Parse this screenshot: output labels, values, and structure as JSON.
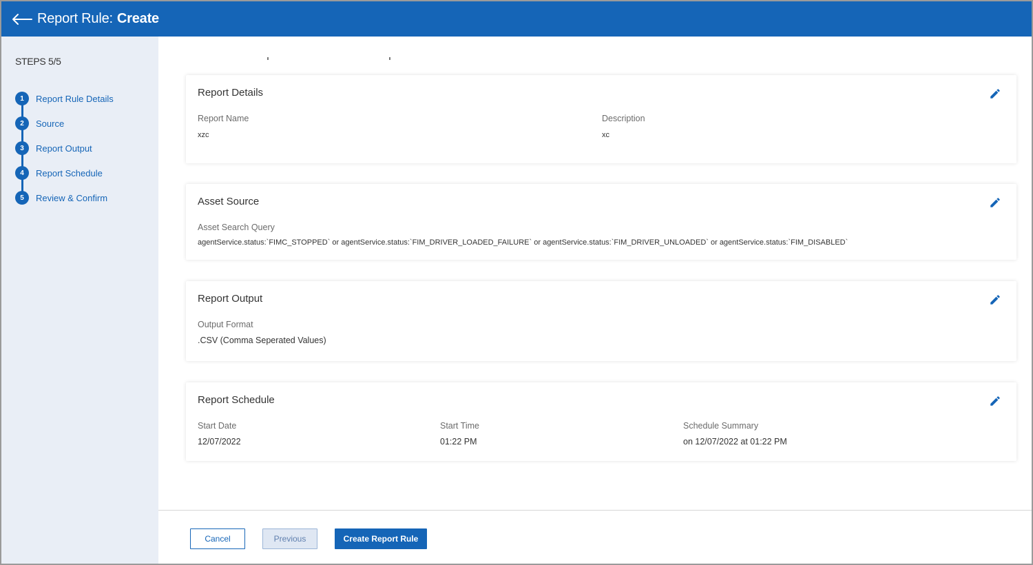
{
  "header": {
    "title_label": "Report Rule:",
    "title_action": "Create"
  },
  "sidebar": {
    "steps_count": "STEPS 5/5",
    "steps": [
      {
        "num": "1",
        "label": "Report Rule Details"
      },
      {
        "num": "2",
        "label": "Source"
      },
      {
        "num": "3",
        "label": "Report Output"
      },
      {
        "num": "4",
        "label": "Report Schedule"
      },
      {
        "num": "5",
        "label": "Review & Confirm"
      }
    ]
  },
  "report_details": {
    "title": "Report Details",
    "report_name_label": "Report Name",
    "report_name_value": "xzc",
    "description_label": "Description",
    "description_value": "xc"
  },
  "asset_source": {
    "title": "Asset Source",
    "query_label": "Asset Search Query",
    "query_value": "agentService.status:`FIMC_STOPPED` or agentService.status:`FIM_DRIVER_LOADED_FAILURE` or agentService.status:`FIM_DRIVER_UNLOADED` or agentService.status:`FIM_DISABLED`"
  },
  "report_output": {
    "title": "Report Output",
    "format_label": "Output Format",
    "format_value": ".CSV (Comma Seperated Values)"
  },
  "report_schedule": {
    "title": "Report Schedule",
    "start_date_label": "Start Date",
    "start_date_value": "12/07/2022",
    "start_time_label": "Start Time",
    "start_time_value": "01:22 PM",
    "summary_label": "Schedule Summary",
    "summary_value": "on 12/07/2022 at 01:22 PM"
  },
  "footer": {
    "cancel_label": "Cancel",
    "previous_label": "Previous",
    "create_label": "Create Report Rule"
  },
  "colors": {
    "brand": "#1565b7",
    "sidebar_bg": "#e9eef6"
  },
  "icons": {
    "back": "arrow-left-icon",
    "edit": "pencil-icon"
  }
}
